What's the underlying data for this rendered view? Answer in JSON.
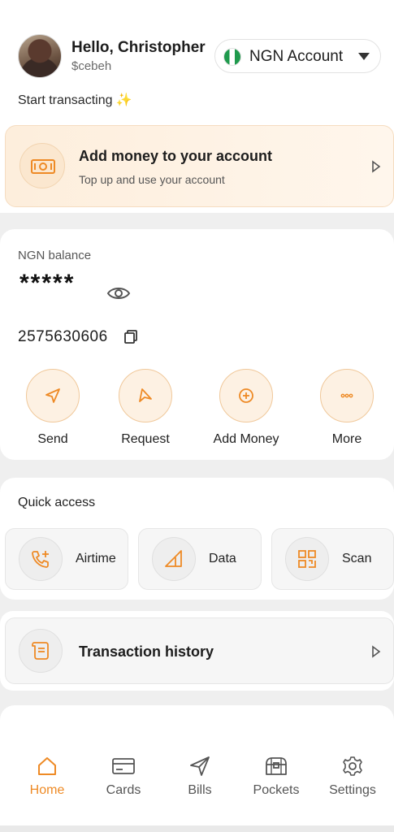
{
  "header": {
    "greeting": "Hello, Christopher",
    "handle": "$cebeh",
    "account_selector": "NGN Account",
    "start_text": "Start transacting",
    "sparkle": "✨"
  },
  "add_money_banner": {
    "title": "Add money to your account",
    "subtitle": "Top up and use your account"
  },
  "balance": {
    "label": "NGN balance",
    "masked_value": "*****",
    "account_number": "2575630606"
  },
  "actions": [
    {
      "label": "Send",
      "icon": "send-icon"
    },
    {
      "label": "Request",
      "icon": "request-icon"
    },
    {
      "label": "Add Money",
      "icon": "plus-circle-icon"
    },
    {
      "label": "More",
      "icon": "more-icon"
    }
  ],
  "quick_access": {
    "title": "Quick access",
    "items": [
      {
        "label": "Airtime",
        "icon": "phone-plus-icon"
      },
      {
        "label": "Data",
        "icon": "signal-icon"
      },
      {
        "label": "Scan",
        "icon": "qr-icon"
      }
    ]
  },
  "transaction_history": {
    "label": "Transaction history"
  },
  "bottom_nav": [
    {
      "label": "Home",
      "icon": "home-icon",
      "active": true
    },
    {
      "label": "Cards",
      "icon": "card-icon",
      "active": false
    },
    {
      "label": "Bills",
      "icon": "send-icon",
      "active": false
    },
    {
      "label": "Pockets",
      "icon": "chest-icon",
      "active": false
    },
    {
      "label": "Settings",
      "icon": "gear-icon",
      "active": false
    }
  ],
  "colors": {
    "accent": "#ee8a25",
    "banner_bg": "#fdeedc"
  }
}
